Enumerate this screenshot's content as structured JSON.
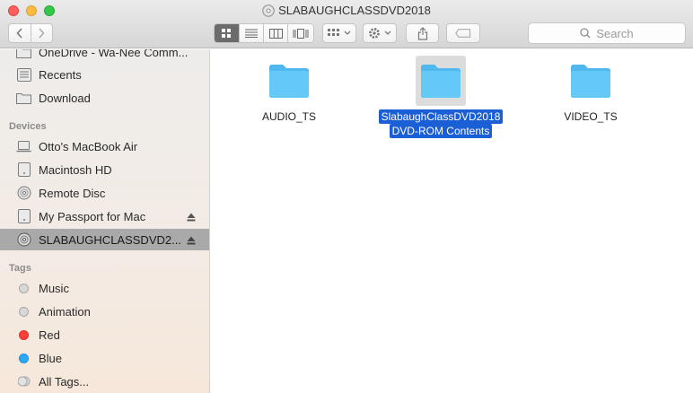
{
  "window": {
    "title": "SLABAUGHCLASSDVD2018"
  },
  "toolbar": {
    "back": "back-arrow",
    "forward": "forward-arrow",
    "view_modes": [
      "icon-view",
      "list-view",
      "column-view",
      "cover-flow-view"
    ],
    "active_view": "icon-view",
    "group_by": "group-icon",
    "action": "gear-icon",
    "share": "share-icon",
    "tag": "tag-icon",
    "search_placeholder": "Search"
  },
  "sidebar": {
    "favorites": [
      {
        "label": "OneDrive - Wa-Nee Comm...",
        "icon": "folder-icon"
      },
      {
        "label": "Recents",
        "icon": "recents-icon"
      },
      {
        "label": "Download",
        "icon": "folder-icon"
      }
    ],
    "devices_header": "Devices",
    "devices": [
      {
        "label": "Otto's MacBook Air",
        "icon": "laptop-icon",
        "eject": false,
        "selected": false
      },
      {
        "label": "Macintosh HD",
        "icon": "disk-icon",
        "eject": false,
        "selected": false
      },
      {
        "label": "Remote Disc",
        "icon": "disc-icon",
        "eject": false,
        "selected": false
      },
      {
        "label": "My Passport for Mac",
        "icon": "disk-icon",
        "eject": true,
        "selected": false
      },
      {
        "label": "SLABAUGHCLASSDVD2...",
        "icon": "disc-icon",
        "eject": true,
        "selected": true
      }
    ],
    "tags_header": "Tags",
    "tags": [
      {
        "label": "Music",
        "color": "#d8d8d8"
      },
      {
        "label": "Animation",
        "color": "#d8d8d8"
      },
      {
        "label": "Red",
        "color": "#fc3d39"
      },
      {
        "label": "Blue",
        "color": "#2fa7f8"
      },
      {
        "label": "All Tags...",
        "color": "#d8d8d8"
      }
    ]
  },
  "files": [
    {
      "name_line1": "AUDIO_TS",
      "name_line2": "",
      "selected": false
    },
    {
      "name_line1": "SlabaughClassDVD2018",
      "name_line2": "DVD-ROM Contents",
      "selected": true
    },
    {
      "name_line1": "VIDEO_TS",
      "name_line2": "",
      "selected": false
    }
  ],
  "colors": {
    "folder": "#5ec7f6",
    "selection": "#1b5fd6"
  }
}
